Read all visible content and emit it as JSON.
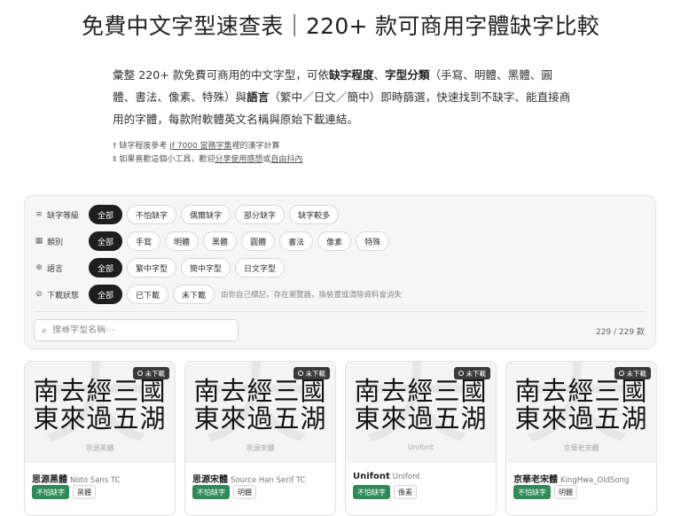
{
  "page": {
    "title": "免費中文字型速查表｜220+ 款可商用字體缺字比較",
    "intro": {
      "p1": "彙整 220+ 款免費可商用的中文字型，可依",
      "b1": "缺字程度",
      "p2": "、",
      "b2": "字型分類",
      "p3": "（手寫、明體、黑體、圓體、書法、像素、特殊）與",
      "b3": "語言",
      "p4": "（繁中／日文／簡中）即時篩選，快速找到不缺字、能直接商用的字體，每款附軟體英文名稱與原始下載連結。"
    },
    "notes": {
      "n1_pre": "† 缺字程度參考 ",
      "n1_link": "jf 7000 當務字集",
      "n1_post": "裡的漢字計算",
      "n2_pre": "‡ 如果喜歡這個小工具，歡迎",
      "n2_link1": "分享使用感想",
      "n2_mid": "或",
      "n2_link2": "自由抖內"
    }
  },
  "filters": {
    "missing": {
      "label": "缺字等級",
      "icon": "filter-lines-icon",
      "options": [
        "全部",
        "不怕缺字",
        "偶爾缺字",
        "部分缺字",
        "缺字較多"
      ]
    },
    "category": {
      "label": "類別",
      "icon": "grid-icon",
      "options": [
        "全部",
        "手寫",
        "明體",
        "黑體",
        "圓體",
        "書法",
        "像素",
        "特殊"
      ]
    },
    "language": {
      "label": "語言",
      "icon": "globe-icon",
      "options": [
        "全部",
        "繁中字型",
        "簡中字型",
        "日文字型"
      ]
    },
    "download": {
      "label": "下載狀態",
      "icon": "check-circle-icon",
      "options": [
        "全部",
        "已下載",
        "未下載"
      ],
      "hint": "由你自己標記，存在瀏覽器，換裝置或清除資料會消失"
    },
    "search_placeholder": "搜尋字型名稱⋯",
    "count": "229 / 229 款"
  },
  "cards": [
    {
      "sample_line1": "南去經三國",
      "sample_line2": "東來過五湖",
      "watermark": "思源黑體",
      "ghost_char": "夭",
      "badge": "未下載",
      "name": "思源黑體",
      "name_en": "Noto Sans TC",
      "tags": [
        "不怕缺字",
        "黑體"
      ]
    },
    {
      "sample_line1": "南去經三國",
      "sample_line2": "東來過五湖",
      "watermark": "思源宋體",
      "ghost_char": "夭",
      "badge": "未下載",
      "name": "思源宋體",
      "name_en": "Source Han Serif TC",
      "tags": [
        "不怕缺字",
        "明體"
      ]
    },
    {
      "sample_line1": "南去經三國",
      "sample_line2": "東來過五湖",
      "watermark": "Unifont",
      "ghost_char": "夭",
      "badge": "未下載",
      "name": "Unifont",
      "name_en": "Unifont",
      "tags": [
        "不怕缺字",
        "像素"
      ]
    },
    {
      "sample_line1": "南去經三國",
      "sample_line2": "東來過五湖",
      "watermark": "京華老宋體",
      "ghost_char": "夭",
      "badge": "未下載",
      "name": "京華老宋體",
      "name_en": "KingHwa_OldSong",
      "tags": [
        "不怕缺字",
        "明體"
      ]
    }
  ]
}
